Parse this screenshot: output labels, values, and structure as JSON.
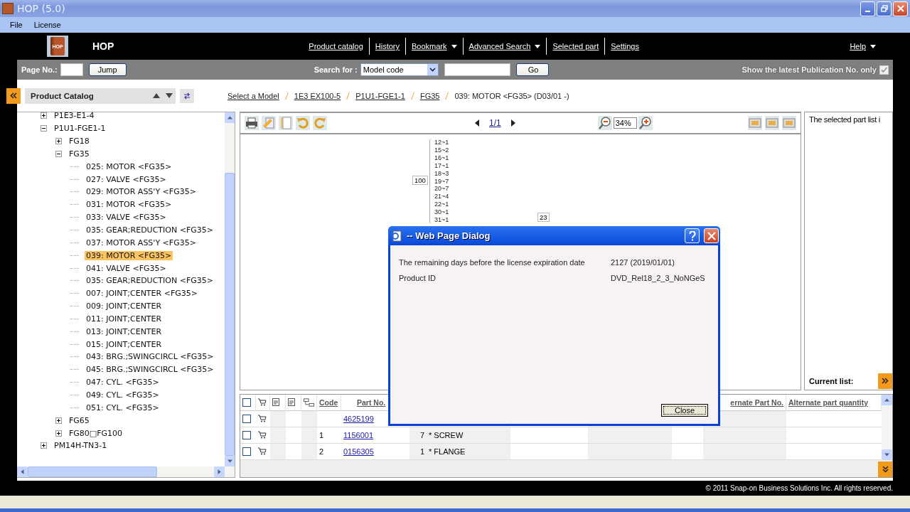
{
  "window": {
    "title": "HOP (5.0)"
  },
  "menu": [
    "File",
    "License"
  ],
  "header": {
    "logo_text": "HOP",
    "app_name": "HOP",
    "nav": [
      {
        "label": "Product catalog",
        "dropdown": false
      },
      {
        "label": "History",
        "dropdown": false
      },
      {
        "label": "Bookmark",
        "dropdown": true
      },
      {
        "label": "Advanced Search",
        "dropdown": true
      },
      {
        "label": "Selected part",
        "dropdown": false
      },
      {
        "label": "Settings",
        "dropdown": false
      }
    ],
    "help": {
      "label": "Help",
      "dropdown": true
    }
  },
  "toolbar": {
    "page_label": "Page No.:",
    "jump": "Jump",
    "search_label": "Search for :",
    "search_type": "Model code",
    "go": "Go",
    "latest_only": {
      "label": "Show the latest Publication No. only",
      "checked": true
    }
  },
  "catalog_panel": {
    "title": "Product Catalog",
    "tree": [
      {
        "label": "P1E3-E1-4",
        "expanded": false,
        "selected": false
      },
      {
        "label": "P1U1-FGE1-1",
        "expanded": true,
        "selected": false,
        "children": [
          {
            "label": "FG18",
            "expanded": false,
            "selected": false
          },
          {
            "label": "FG35",
            "expanded": true,
            "selected": false,
            "children": [
              {
                "label": "025: MOTOR <FG35>",
                "selected": false
              },
              {
                "label": "027: VALVE <FG35>",
                "selected": false
              },
              {
                "label": "029: MOTOR ASS'Y <FG35>",
                "selected": false
              },
              {
                "label": "031: MOTOR <FG35>",
                "selected": false
              },
              {
                "label": "033: VALVE <FG35>",
                "selected": false
              },
              {
                "label": "035: GEAR;REDUCTION <FG35>",
                "selected": false
              },
              {
                "label": "037: MOTOR ASS'Y <FG35>",
                "selected": false
              },
              {
                "label": "039: MOTOR <FG35>",
                "selected": true
              },
              {
                "label": "041: VALVE <FG35>",
                "selected": false
              },
              {
                "label": "035: GEAR;REDUCTION <FG35>",
                "selected": false
              },
              {
                "label": "007: JOINT;CENTER <FG35>",
                "selected": false
              },
              {
                "label": "009: JOINT;CENTER",
                "selected": false
              },
              {
                "label": "011: JOINT;CENTER",
                "selected": false
              },
              {
                "label": "013: JOINT;CENTER",
                "selected": false
              },
              {
                "label": "015: JOINT;CENTER",
                "selected": false
              },
              {
                "label": "043: BRG.;SWINGCIRCL <FG35>",
                "selected": false
              },
              {
                "label": "045: BRG.;SWINGCIRCL <FG35>",
                "selected": false
              },
              {
                "label": "047: CYL. <FG35>",
                "selected": false
              },
              {
                "label": "049: CYL. <FG35>",
                "selected": false
              },
              {
                "label": "051: CYL. <FG35>",
                "selected": false
              }
            ]
          },
          {
            "label": "FG65",
            "expanded": false,
            "selected": false
          },
          {
            "label": "FG80□FG100",
            "expanded": false,
            "selected": false
          }
        ]
      },
      {
        "label": "PM14H-TN3-1",
        "expanded": false,
        "selected": false
      }
    ]
  },
  "breadcrumb": {
    "links": [
      "Select a Model",
      "1E3 EX100-5",
      "P1U1-FGE1-1",
      "FG35"
    ],
    "current": "039: MOTOR <FG35> (D03/01 -)"
  },
  "viewer": {
    "page": "1/1",
    "zoom": "34%",
    "diagram": {
      "callout": "100",
      "items": [
        "12~1",
        "15~2",
        "16~1",
        "17~1",
        "18~3",
        "19~7",
        "20~7",
        "21~4",
        "22~1",
        "30~1",
        "31~1"
      ],
      "callout_2": "23"
    }
  },
  "selected_panel": {
    "text": "The selected part list i",
    "current_label": "Current list:"
  },
  "parts_table": {
    "select_all_checked": false,
    "columns": {
      "code": "Code",
      "part_no": "Part No.",
      "alternate_part_no": "ernate Part No.",
      "alternate_quantity": "Alternate part quantity"
    },
    "rows": [
      {
        "checked": false,
        "part_no": "4625199"
      },
      {
        "checked": false,
        "code": "1",
        "part_no": "1156001",
        "quantity": "7",
        "name": "* SCREW"
      },
      {
        "checked": false,
        "code": "2",
        "part_no": "0156305",
        "quantity": "1",
        "name": "* FLANGE"
      }
    ]
  },
  "footer": "© 2011 Snap-on Business Solutions Inc. All rights reserved.",
  "dialog": {
    "title": "-- Web Page Dialog",
    "rows": [
      {
        "label": "The remaining days before the license expiration date",
        "value": "2127 (2019/01/01)"
      },
      {
        "label": "Product ID",
        "value": "DVD_Rel18_2_3_NoNGeS"
      }
    ],
    "button": "Close"
  }
}
